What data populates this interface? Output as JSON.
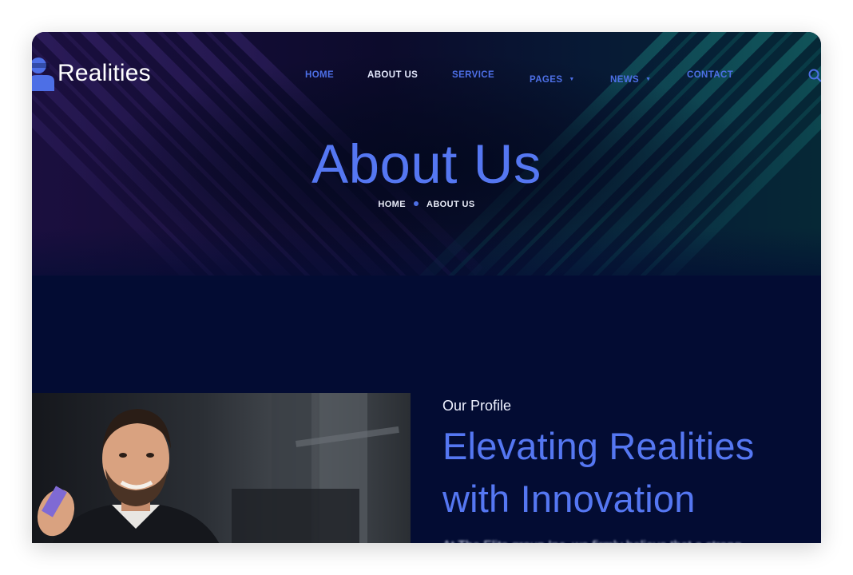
{
  "brand": {
    "name": "Realities"
  },
  "nav": {
    "items": [
      {
        "label": "HOME"
      },
      {
        "label": "ABOUT US"
      },
      {
        "label": "SERVICE"
      },
      {
        "label": "PAGES"
      },
      {
        "label": "NEWS"
      },
      {
        "label": "CONTACT"
      }
    ],
    "active": "ABOUT US",
    "dropdown_caret": "▼"
  },
  "hero": {
    "title": "About Us",
    "breadcrumb": [
      "HOME",
      "ABOUT US"
    ]
  },
  "profile": {
    "label": "Our Profile",
    "title_line1": "Elevating Realities",
    "title_line2": "with Innovation",
    "text": "At The Elite group Inc, we firmly believe that a strong"
  },
  "colors": {
    "background": "#030c33",
    "accent": "#5577f2",
    "nav_link": "#4d6fe6",
    "nav_active": "#e6ebff"
  },
  "icons": [
    "logo-icon",
    "search-icon",
    "chevron-down-icon"
  ]
}
